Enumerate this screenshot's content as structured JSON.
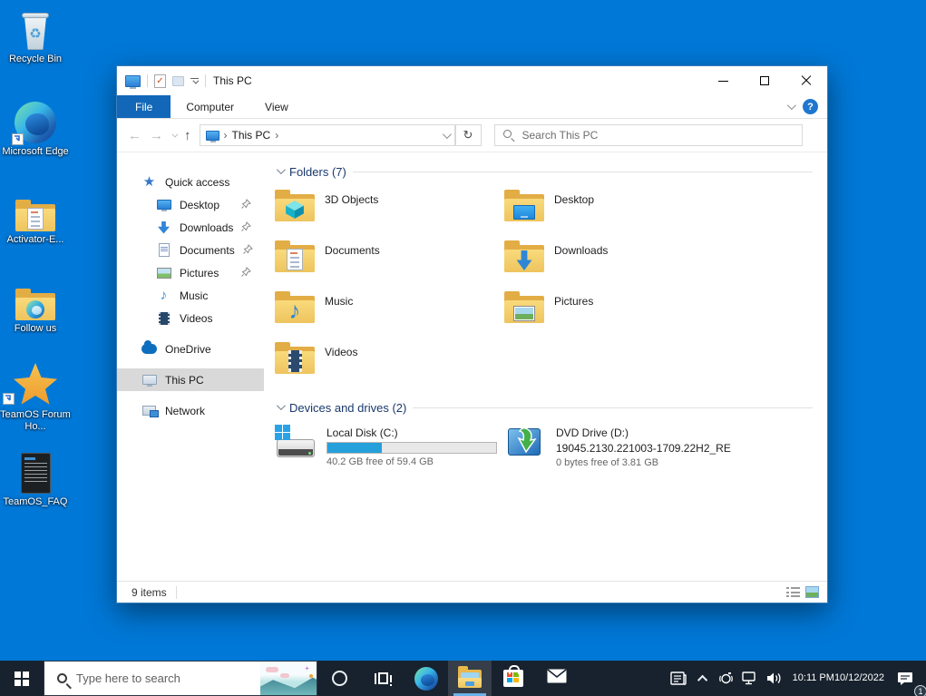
{
  "desktop": {
    "icons": [
      {
        "label": "Recycle Bin"
      },
      {
        "label": "Microsoft Edge"
      },
      {
        "label": "Activator-E..."
      },
      {
        "label": "Follow us"
      },
      {
        "label": "TeamOS Forum Ho..."
      },
      {
        "label": "TeamOS_FAQ"
      }
    ]
  },
  "glyphs": {
    "back": "←",
    "forward": "→",
    "up": "↑",
    "refresh": "↻",
    "breadcrumb_sep": "›",
    "help": "?",
    "recycle": "♻",
    "music_note": "♪",
    "properties_check": "✓"
  },
  "explorer": {
    "title": "This PC",
    "ribbon": {
      "tabs": [
        "File",
        "Computer",
        "View"
      ],
      "active_tab": "File"
    },
    "navigation": {
      "breadcrumb": "This PC",
      "search_placeholder": "Search This PC"
    },
    "sidebar": {
      "items": [
        {
          "label": "Quick access"
        },
        {
          "label": "Desktop"
        },
        {
          "label": "Downloads"
        },
        {
          "label": "Documents"
        },
        {
          "label": "Pictures"
        },
        {
          "label": "Music"
        },
        {
          "label": "Videos"
        },
        {
          "label": "OneDrive"
        },
        {
          "label": "This PC"
        },
        {
          "label": "Network"
        }
      ],
      "selected": "This PC"
    },
    "content": {
      "groups": [
        {
          "title": "Folders (7)"
        },
        {
          "title": "Devices and drives (2)"
        }
      ],
      "folders": [
        {
          "name": "3D Objects"
        },
        {
          "name": "Desktop"
        },
        {
          "name": "Documents"
        },
        {
          "name": "Downloads"
        },
        {
          "name": "Music"
        },
        {
          "name": "Pictures"
        },
        {
          "name": "Videos"
        }
      ],
      "drives": [
        {
          "name": "Local Disk (C:)",
          "free_text": "40.2 GB free of 59.4 GB",
          "used_percent": 32
        },
        {
          "name": "DVD Drive (D:)",
          "line2": "19045.2130.221003-1709.22H2_RE",
          "free_text": "0 bytes free of 3.81 GB"
        }
      ]
    },
    "status_bar": {
      "items_text": "9 items"
    }
  },
  "taskbar": {
    "search_placeholder": "Type here to search",
    "clock": {
      "time": "10:11 PM",
      "date": "10/12/2022"
    },
    "notification_badge": "1"
  },
  "colors": {
    "desktop_background": "#0078d7",
    "file_tab": "#1267b8",
    "sidebar_selection": "#d9d9d9",
    "group_header_text": "#19396d",
    "drive_bar_fill": "#26a0da",
    "taskbar": "#18222e"
  }
}
